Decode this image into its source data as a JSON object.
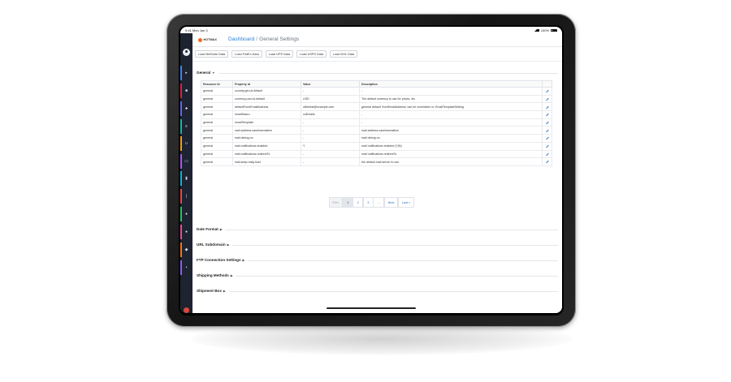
{
  "status_bar": {
    "time": "9:41",
    "date": "Mon Jun 3",
    "battery": "100%"
  },
  "header": {
    "logo_text": "HOTWAX",
    "breadcrumb": {
      "root": "Dashboard",
      "separator": "/",
      "current": "General Settings"
    }
  },
  "toolbar": {
    "buttons": [
      "Load NetSuite Data",
      "Load FedEx Data",
      "Load UPS Data",
      "Load USPS Data",
      "Load DHL Data"
    ]
  },
  "general": {
    "title": "General",
    "columns": [
      "Resource Id",
      "Property Id",
      "Value",
      "Description"
    ],
    "rows": [
      [
        "general",
        "country.geo.id.default",
        "-",
        "-"
      ],
      [
        "general",
        "currency.uom.id.default",
        "USD",
        "The default currency to use for prices, etc"
      ],
      [
        "general",
        "defaultFromEmailAddress",
        "ofbiztest@example.com",
        "general default 'fromEmailAddress' can be overridden in: EmailTemplateSetting"
      ],
      [
        "general",
        "emailMacro",
        "coEmails",
        "-"
      ],
      [
        "general",
        "emailTemplate",
        "-",
        "-"
      ],
      [
        "general",
        "mail.address.caseInsensitive",
        "-",
        "mail address caseInsensitive"
      ],
      [
        "general",
        "mail.debug.on",
        "-",
        "mail debug on"
      ],
      [
        "general",
        "mail.notifications.enabled",
        "Y",
        "mail notifications enabled (Y|N)"
      ],
      [
        "general",
        "mail.notifications.redirectTo",
        "-",
        "mail notifications redirectTo"
      ],
      [
        "general",
        "mail.smtp.relay.host",
        "-",
        "the default mail server to use"
      ]
    ]
  },
  "pagination": {
    "prev": "Prev",
    "pages": [
      "1",
      "2",
      "3",
      "…"
    ],
    "active_page": "1",
    "next": "Next",
    "last": "Last »"
  },
  "sections": [
    {
      "title": "Date Format"
    },
    {
      "title": "URL Subdomain"
    },
    {
      "title": "FTP Connection Settings"
    },
    {
      "title": "Shipping Methods"
    },
    {
      "title": "Shipment Box"
    }
  ],
  "icons": {
    "menu": "hamburger-icon",
    "edit": "pencil-icon",
    "caret_open": "caret-down-icon",
    "caret_closed": "caret-right-icon"
  },
  "colors": {
    "sidebar_bg": "#1d2330",
    "link": "#2f7fd6",
    "brand": "#f26b1d",
    "sidebar_accents": [
      "#3b82f6",
      "#e11d48",
      "#6366f1",
      "#14b8a6",
      "#f59e0b",
      "#a855f7",
      "#06b6d4",
      "#ef4444",
      "#22c55e",
      "#ec4899",
      "#f97316",
      "#8b5cf6"
    ]
  }
}
